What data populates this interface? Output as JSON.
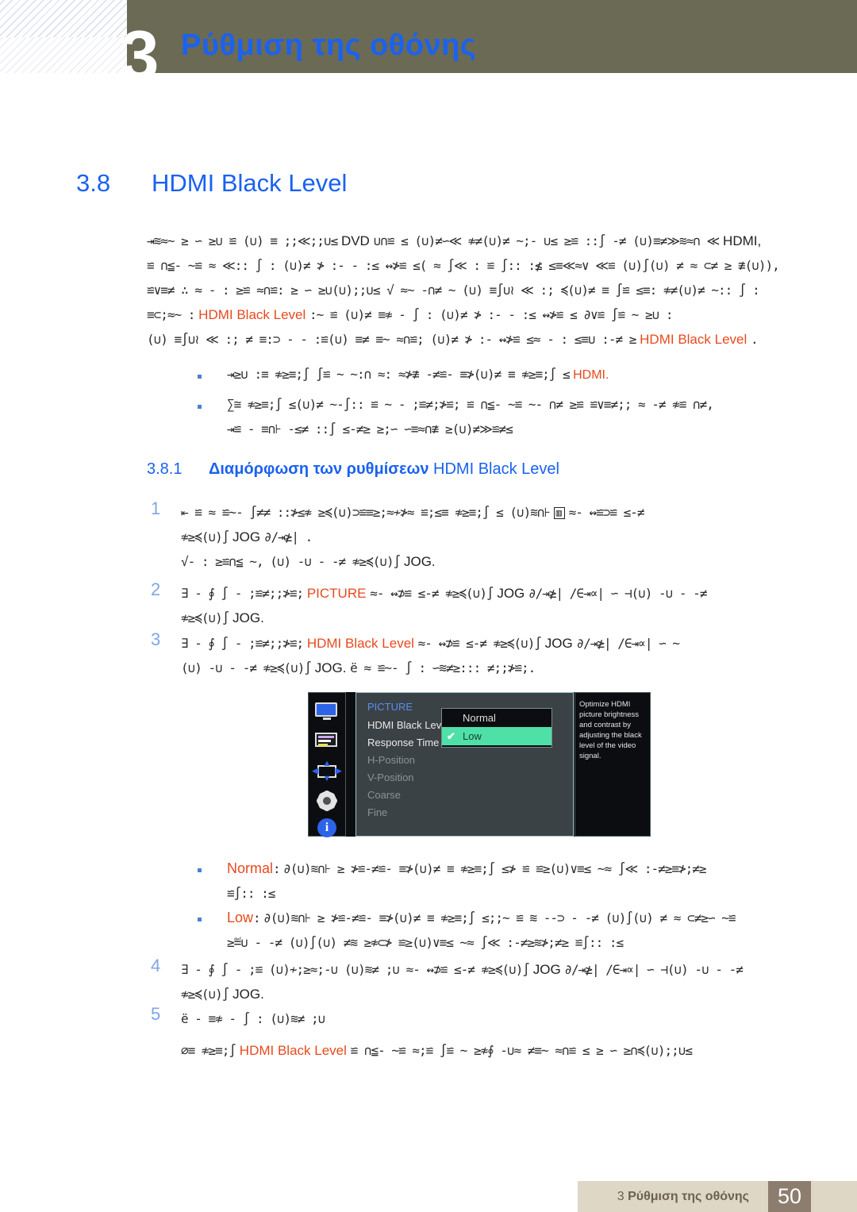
{
  "header": {
    "chapter_number": "3",
    "chapter_title": "Ρύθμιση της οθόνης",
    "band_color": "#6b6a55",
    "title_color": "#1a62f0"
  },
  "section": {
    "number": "3.8",
    "title": "HDMI Black Level"
  },
  "intro": {
    "line1_a": "⇥≋≈~  ≥ ∽ ≥∪ ≌ (∪) ≡ ;;≪;;∪≤",
    "line1_lat1": "DVD",
    "line1_b": "∪∩≌ ≤ (∪)≠∽≪ ≉≠(∪)≠ ~;- ∪≤  ≥≌  ::∫ -≠ (∪)≡≠≫≋≈∩ ≪",
    "line1_lat2": "HDMI,",
    "line2": "≌ ∩≦- ~≌ ≈ ≪:: ∫ : (∪)≠ ≯ :- - :≤ ↭≯≌ ≤( ≈ ∫≪ : ≌ ∫:: :≰ ≤≡≪≈∨ ≪≌ (∪)∫(∪) ≠ ≈ ⊂≠ ≥ ≇(∪)),",
    "line3": "≌∨≡≠ ∴ ≈ - : ≥≌    ≈∩≌: ≥ ∽ ≥∪(∪);;∪≤ √ ≈~ -∩≠ ~ (∪) ≡∫∪≀ ≪ :; ≼(∪)≠ ≡ ∫≌ ≤≡: ≉≠(∪)≠ ~:: ∫ :",
    "line4_a": "≡⊂;≈~ :",
    "line4_hl": "HDMI Black Level",
    "line4_b": ":~ ≌ (∪)≠  ≡≉ - ∫ : (∪)≠ ≯ :- - :≤ ↭≯≌ ≤ ∂∨≌ ∫≌ ~ ≥∪ :",
    "line5_a": "(∪) ≡∫∪≀ ≪ :; ≠ ≡:⊃ - - :≌(∪) ≡≠ ≡~ ≈∩≌; (∪)≠ ≯ :-   ↭≯≌ ≤≈ - : ≤≡∪ :-≠ ≥",
    "line5_hl": "HDMI Black Level",
    "line5_b": "."
  },
  "intro_bullets": [
    {
      "text_a": "⇥≥∪ :≡ ≉≥≡;∫  ∫≌ ~ ~:∩ ≈: ≈≯≇  -≠≌- ≡≯(∪)≠ ≡ ≉≥≡;∫ ≤",
      "hl": "HDMI.",
      "text_b": ""
    },
    {
      "text_a": "∑≅ ≉≥≡;∫ ≤(∪)≠ ~-∫:: ≌ ~ - ;≌≠;≯≌; ≌ ∩≦- ~≌  ~- ∩≠ ≥≌ ≌∨≡≠;; ≈ -≠ ≉≌ ∩≠,",
      "text_line2": "⇥≌ - ≡∩⊦  -≤≠ ::∫ ≤-≠≥  ≥;∽ ∽≡≈∩≇ ≥(∪)≠≫≌≠≤"
    }
  ],
  "subsection": {
    "number": "3.8.1",
    "title_bold": "Διαμόρφωση των ρυθμίσεων",
    "title_latin": "HDMI Black Level"
  },
  "steps": [
    {
      "num": "1",
      "line1_a": "⇤ ≌ ≈ ≌~- ∫≠≠ ::≯≤≉ ≥≼(∪)⊃≌≡≥;≈≁≯≈ ≌;≤≡ ≉≥≡;∫ ≤ (∪)≋∩⊦",
      "line1_icon": "▥",
      "line1_b": "≈- ↭≌⊃≌ ≤-≠",
      "line2_a": "≉≥≼(∪)∫",
      "line2_lat": "JOG",
      "line2_b": "∂/⇥≱| .",
      "line3_a": "√- :  ≥≌∩≦ ~, (∪) -∪ - -≠ ≉≥≼(∪)∫",
      "line3_lat": "JOG."
    },
    {
      "num": "2",
      "line1_a": "∃ - ∮ ∫  - ;≌≠;;≯≌;",
      "line1_hl": "PICTURE",
      "line1_b": "≈- ↭⊅≌ ≤-≠ ≉≥≼(∪)∫",
      "line1_lat": "JOG",
      "line1_c": "∂/⇥≱| /∈⇥∝| ∽ ⊣(∪) -∪ - -≠",
      "line2_a": "≉≥≼(∪)∫",
      "line2_lat": "JOG."
    },
    {
      "num": "3",
      "line1_a": "∃ - ∮ ∫  - ;≌≠;;≯≌;",
      "line1_hl": "HDMI Black Level",
      "line1_b": "≈- ↭⊅≌ ≤-≠ ≉≥≼(∪)∫",
      "line1_lat": "JOG",
      "line1_c": "∂/⇥≱| /∈⇥∝| ∽ ~",
      "line2_a": "(∪) -∪ - -≠ ≉≥≼(∪)∫",
      "line2_lat": "JOG.",
      "line2_b": "ë   ≈ ≌~- ∫ : ∽≋≠≥::: ≠;;≯≌;."
    }
  ],
  "osd": {
    "title": "PICTURE",
    "items": [
      {
        "label": "HDMI Black Level",
        "dim": false
      },
      {
        "label": "Response Time",
        "dim": false
      },
      {
        "label": "H-Position",
        "dim": true
      },
      {
        "label": "V-Position",
        "dim": true
      },
      {
        "label": "Coarse",
        "dim": true
      },
      {
        "label": "Fine",
        "dim": true
      }
    ],
    "dropdown": {
      "options": [
        {
          "label": "Normal",
          "selected": false
        },
        {
          "label": "Low",
          "selected": true
        }
      ],
      "check_glyph": "✔",
      "highlight_color": "#4fe0a8"
    },
    "description": "Optimize HDMI picture brightness and contrast by adjusting the black level of the video signal.",
    "icons": [
      "monitor-icon",
      "osd-list-icon",
      "position-arrows-icon",
      "gear-icon",
      "info-icon"
    ]
  },
  "option_bullets": [
    {
      "name": "Normal",
      "sep": ":",
      "line1": "∂(∪)≋∩⊦  ≥ ≯≌-≠≌- ≡≯(∪)≠ ≡ ≉≥≡;∫ ≤≯ ≌  ≌≥(∪)∨≡≤ ~≈ ∫≪ :-≠≥≡≯;≠≥",
      "line2": "≌∫:: :≤"
    },
    {
      "name": "Low",
      "sep": ":",
      "line1": "∂(∪)≋∩⊦  ≥ ≯≌-≠≌- ≡≯(∪)≠ ≡ ≉≥≡;∫ ≤;;~ ≌ ≋ --⊃ - -≠ (∪)∫(∪) ≠ ≈ ⊂≠≥∽ ~≌",
      "line2": "≥≝∪ - -≠ (∪)∫(∪) ≠≋ ≥≉⊂≯ ≌≥(∪)∨≡≤ ~≈ ∫≪ :-≠≥≋≯;≠≥ ≌∫:: :≤"
    }
  ],
  "steps_tail": [
    {
      "num": "4",
      "line1_a": "∃ - ∮ ∫  - ;≌ (∪)≁;≥≈;-∪ (∪)≋≠ ;∪ ≈- ↭⊅≌ ≤-≠ ≉≥≼(∪)∫",
      "line1_lat": "JOG",
      "line1_b": "∂/⇥≱| /∈⇥∝| ∽ ⊣(∪) -∪ - -≠",
      "line2_a": "≉≥≼(∪)∫",
      "line2_lat": "JOG."
    },
    {
      "num": "5",
      "line1": "ë  - ≡≉ - ∫ : (∪)≋≠ ;∪"
    }
  ],
  "final_note": {
    "prefix": "∅≡ ≉≥≡;∫",
    "hl": "HDMI Black Level",
    "suffix": "≌ ∩≦- ~≌ ≈;≌ ∫≌ ~ ≥≉∮ -∪≈ ≠≡~ ≈∩≌ ≤ ≥ ∽ ≥∩≼(∪);;∪≤"
  },
  "footer": {
    "chapter_num": "3",
    "chapter_title": "Ρύθμιση της οθόνης",
    "page_number": "50",
    "bar_color": "#ded7c6",
    "page_box_color": "#8d7d6e"
  }
}
